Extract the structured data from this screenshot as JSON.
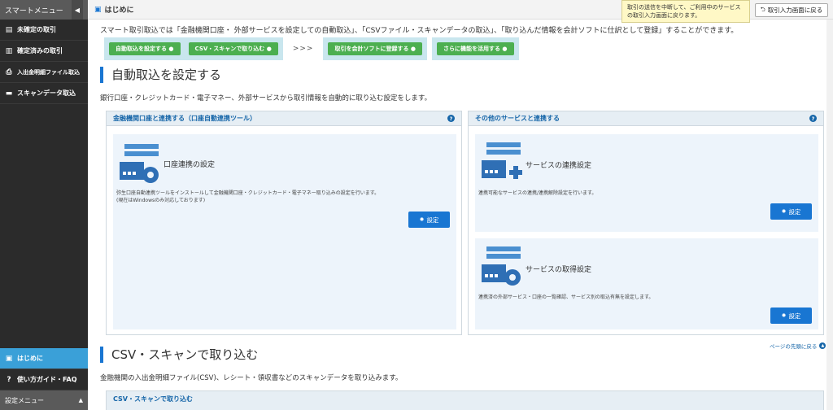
{
  "sidebar": {
    "header": "スマートメニュー",
    "collapse_icon": "chevron-left-icon",
    "items": [
      {
        "label": "未確定の取引",
        "icon": "list-icon"
      },
      {
        "label": "確定済みの取引",
        "icon": "document-icon"
      },
      {
        "label": "入出金明細ファイル取込",
        "icon": "file-import-icon"
      },
      {
        "label": "スキャンデータ取込",
        "icon": "scanner-icon"
      }
    ],
    "bottom_items": [
      {
        "label": "はじめに",
        "icon": "book-icon",
        "active": true
      },
      {
        "label": "使い方ガイド・FAQ",
        "icon": "help-circle-icon"
      }
    ],
    "footer": "設定メニュー"
  },
  "topbar": {
    "title": "はじめに",
    "tooltip": "取引の送信を中断して、ご利用中のサービスの取引入力画面に戻ります。",
    "back_button": "取引入力画面に戻る"
  },
  "intro": "スマート取引取込では「金融機関口座・ 外部サービスを設定しての自動取込」、「CSVファイル・スキャンデータの取込」、「取り込んだ情報を会計ソフトに仕訳として登録」することができます。",
  "steps": {
    "btn1": "自動取込を設定する",
    "btn2": "CSV・スキャンで取り込む",
    "arrow": ">>>",
    "btn3": "取引を会計ソフトに登録する",
    "btn4": "さらに機能を活用する"
  },
  "section1": {
    "title": "自動取込を設定する",
    "desc": "銀行口座・クレジットカード・電子マネー、外部サービスから取引情報を自動的に取り込む設定をします。",
    "left_panel": {
      "title": "金融機関口座と連携する（口座自動連携ツール）",
      "card_title": "口座連携の設定",
      "card_text1": "弥生口座自動連携ツールをインストールして金融機関口座・クレジットカード・電子マネー取り込みの設定を行います。",
      "card_text2": "(現在はWindowsのみ対応しております)",
      "button": "設定"
    },
    "right_panel": {
      "title": "その他のサービスと連携する",
      "card1_title": "サービスの連携設定",
      "card1_text": "連携可能なサービスの連携/連携解除設定を行います。",
      "card1_button": "設定",
      "card2_title": "サービスの取得設定",
      "card2_text": "連携済の外部サービス・口座の一覧確認、サービス別の取込有無を設定します。",
      "card2_button": "設定"
    },
    "page_top": "ページの先頭に戻る"
  },
  "section2": {
    "title": "CSV・スキャンで取り込む",
    "desc": "金融機関の入出金明細ファイル(CSV)、レシート・領収書などのスキャンデータを取り込みます。",
    "panel_title": "CSV・スキャンで取り込む"
  },
  "colors": {
    "accent": "#1976d2",
    "step_green": "#4caf50",
    "sidebar_bg": "#2b2b2b",
    "active": "#3aa0d8",
    "card_bg": "#edf4fb"
  }
}
